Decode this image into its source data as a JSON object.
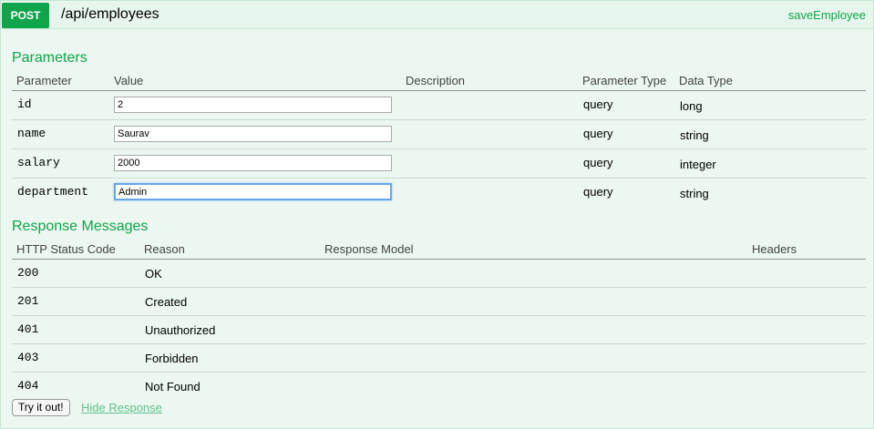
{
  "operation": {
    "method": "POST",
    "path": "/api/employees",
    "nickname": "saveEmployee"
  },
  "parameters": {
    "title": "Parameters",
    "headers": [
      "Parameter",
      "Value",
      "Description",
      "Parameter Type",
      "Data Type"
    ],
    "rows": [
      {
        "name": "id",
        "value": "2",
        "description": "",
        "param_type": "query",
        "data_type": "long"
      },
      {
        "name": "name",
        "value": "Saurav",
        "description": "",
        "param_type": "query",
        "data_type": "string"
      },
      {
        "name": "salary",
        "value": "2000",
        "description": "",
        "param_type": "query",
        "data_type": "integer"
      },
      {
        "name": "department",
        "value": "Admin",
        "description": "",
        "param_type": "query",
        "data_type": "string"
      }
    ]
  },
  "responses": {
    "title": "Response Messages",
    "headers": [
      "HTTP Status Code",
      "Reason",
      "Response Model",
      "Headers"
    ],
    "rows": [
      {
        "code": "200",
        "reason": "OK"
      },
      {
        "code": "201",
        "reason": "Created"
      },
      {
        "code": "401",
        "reason": "Unauthorized"
      },
      {
        "code": "403",
        "reason": "Forbidden"
      },
      {
        "code": "404",
        "reason": "Not Found"
      }
    ]
  },
  "actions": {
    "try_label": "Try it out!",
    "hide_label": "Hide Response"
  },
  "colors": {
    "method_bg": "#10a54a",
    "accent": "#10a54a",
    "panel_bg": "#ebf7f0"
  }
}
